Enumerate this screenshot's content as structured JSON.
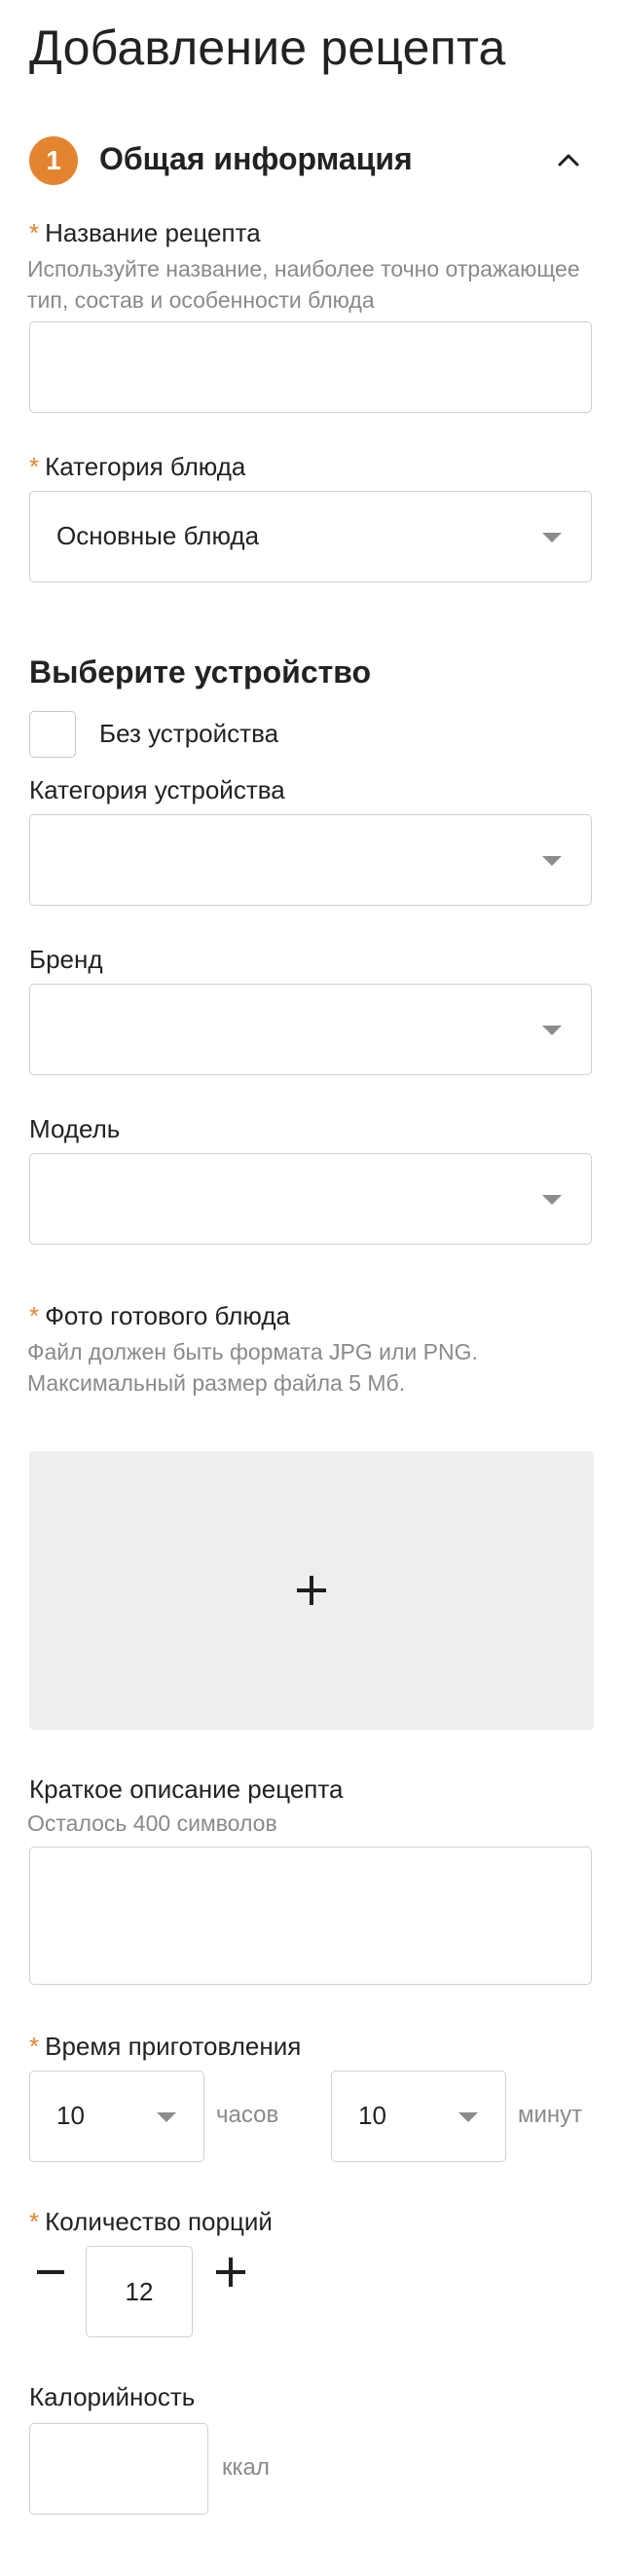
{
  "page": {
    "title": "Добавление рецепта"
  },
  "section": {
    "step_number": "1",
    "title": "Общая информация"
  },
  "recipe_name": {
    "required_mark": "*",
    "label": "Название рецепта",
    "hint": "Используйте название, наиболее точно отражающее тип, состав и особенности блюда",
    "value": ""
  },
  "dish_category": {
    "required_mark": "*",
    "label": "Категория блюда",
    "selected": "Основные блюда"
  },
  "device": {
    "heading": "Выберите устройство",
    "no_device_label": "Без устройства",
    "no_device_checked": false,
    "category_label": "Категория устройства",
    "category_selected": "",
    "brand_label": "Бренд",
    "brand_selected": "",
    "model_label": "Модель",
    "model_selected": ""
  },
  "photo": {
    "required_mark": "*",
    "label": "Фото готового блюда",
    "hint": "Файл должен быть формата JPG или PNG. Максимальный размер файла 5 Мб."
  },
  "description": {
    "label": "Краткое описание рецепта",
    "hint": "Осталось 400 символов",
    "value": ""
  },
  "cook_time": {
    "required_mark": "*",
    "label": "Время приготовления",
    "hours_value": "10",
    "hours_unit": "часов",
    "minutes_value": "10",
    "minutes_unit": "минут"
  },
  "servings": {
    "required_mark": "*",
    "label": "Количество порций",
    "value": "12"
  },
  "calories": {
    "label": "Калорийность",
    "value": "",
    "unit": "ккал"
  },
  "colors": {
    "accent": "#e4842f",
    "border": "#d0d0d0",
    "hint_text": "#8a8a8a",
    "drop_zone": "#eeeeef"
  }
}
